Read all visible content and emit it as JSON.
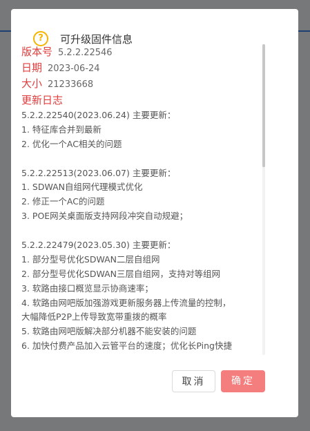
{
  "dialog": {
    "title": "可升级固件信息",
    "icon": "help-circle-icon",
    "accent_color": "#f5b400"
  },
  "fields": {
    "version_label": "版本号",
    "version_value": "5.2.2.22546",
    "date_label": "日期",
    "date_value": "2023-06-24",
    "size_label": "大小",
    "size_value": "21233668",
    "changelog_label": "更新日志"
  },
  "changelog": [
    "5.2.2.22540(2023.06.24)  主要更新：",
    "1. 特征库合并到最新",
    "2. 优化一个AC相关的问题",
    "",
    "5.2.2.22513(2023.06.07)  主要更新：",
    "1. SDWAN自组网代理模式优化",
    "2. 修正一个AC的问题",
    "3. POE网关桌面版支持网段冲突自动规避；",
    "",
    "5.2.2.22479(2023.05.30)  主要更新：",
    "1. 部分型号优化SDWAN二层自组网",
    "2. 部分型号优化SDWAN三层自组网，支持对等组网",
    "3. 软路由接口概览显示协商速率；",
    "4. 软路由网吧版加强游戏更新服务器上传流量的控制，",
    "大幅降低P2P上传导致宽带重拨的概率",
    "5. 软路由网吧版解决部分机器不能安装的问题",
    "6. 加快付费产品加入云管平台的速度；优化长Ping快捷"
  ],
  "buttons": {
    "cancel": "取消",
    "ok": "确定"
  },
  "colors": {
    "label_red": "#e03c3c",
    "ok_button": "#f47d7d",
    "app_header_blue": "#3d7ede"
  }
}
